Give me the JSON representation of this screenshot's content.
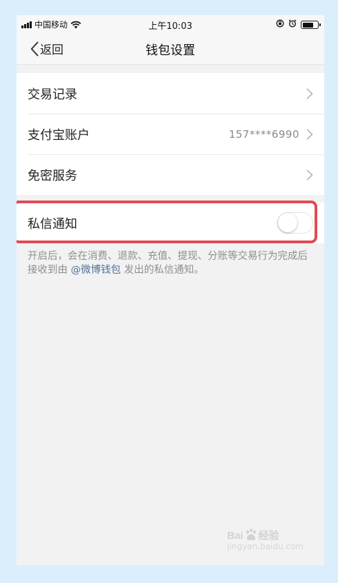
{
  "status_bar": {
    "carrier": "中国移动",
    "time": "上午10:03",
    "icons": [
      "signal-icon",
      "wifi-icon",
      "rotation-lock-icon",
      "alarm-icon",
      "battery-icon"
    ]
  },
  "nav": {
    "back_label": "返回",
    "title": "钱包设置"
  },
  "settings": {
    "items": [
      {
        "label": "交易记录",
        "value": ""
      },
      {
        "label": "支付宝账户",
        "value": "157****6990"
      },
      {
        "label": "免密服务",
        "value": ""
      }
    ]
  },
  "notification": {
    "label": "私信通知",
    "enabled": false,
    "description_prefix": "开启后，会在消费、退款、充值、提现、分账等交易行为完成后接收到由 ",
    "description_link": "@微博钱包",
    "description_suffix": " 发出的私信通知。"
  },
  "watermark": {
    "text_left": "Bai",
    "text_right": "经验",
    "sub": "jingyan.baidu.com"
  },
  "colors": {
    "background": "#dbeefc",
    "page": "#f2f2f2",
    "highlight": "#e04a54",
    "link": "#50709a"
  }
}
